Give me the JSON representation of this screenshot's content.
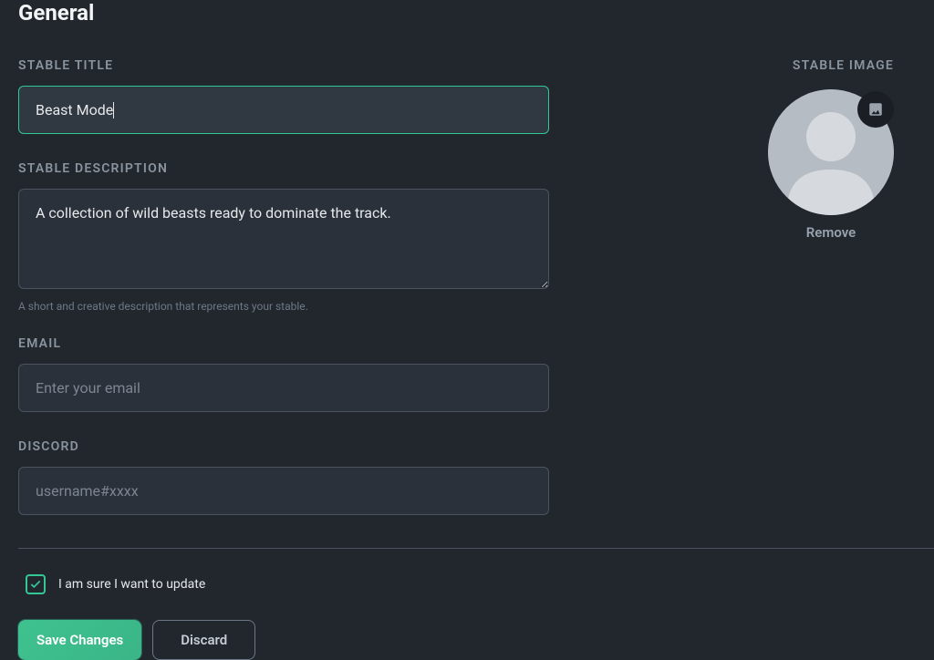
{
  "page": {
    "title": "General"
  },
  "fields": {
    "stable_title": {
      "label": "STABLE TITLE",
      "value": "Beast Mode"
    },
    "stable_description": {
      "label": "STABLE DESCRIPTION",
      "value": "A collection of wild beasts ready to dominate the track.",
      "hint": "A short and creative description that represents your stable."
    },
    "email": {
      "label": "EMAIL",
      "value": "",
      "placeholder": "Enter your email"
    },
    "discord": {
      "label": "DISCORD",
      "value": "",
      "placeholder": "username#xxxx"
    }
  },
  "image_section": {
    "label": "STABLE IMAGE",
    "remove_label": "Remove"
  },
  "confirm": {
    "checked": true,
    "label": "I am sure I want to update"
  },
  "buttons": {
    "save": "Save Changes",
    "discard": "Discard"
  }
}
